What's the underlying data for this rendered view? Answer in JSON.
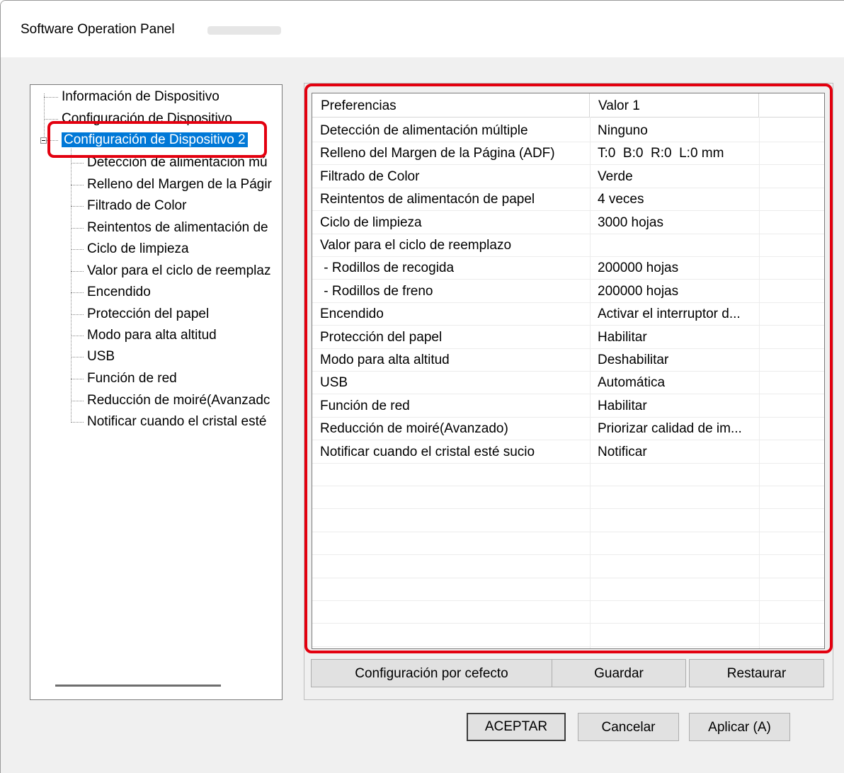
{
  "window": {
    "title": "Software Operation Panel"
  },
  "tree": {
    "items": [
      {
        "label": "Información de Dispositivo"
      },
      {
        "label": "Configuración de Dispositivo"
      },
      {
        "label": "Configuración de Dispositivo 2"
      },
      {
        "label": "Detección de alimentación mú"
      },
      {
        "label": "Relleno del Margen de la Págir"
      },
      {
        "label": "Filtrado de Color"
      },
      {
        "label": "Reintentos de alimentación de"
      },
      {
        "label": "Ciclo de limpieza"
      },
      {
        "label": "Valor para el ciclo de reemplaz"
      },
      {
        "label": "Encendido"
      },
      {
        "label": "Protección del papel"
      },
      {
        "label": "Modo para alta altitud"
      },
      {
        "label": "USB"
      },
      {
        "label": "Función de red"
      },
      {
        "label": "Reducción de moiré(Avanzadc"
      },
      {
        "label": "Notificar cuando el cristal esté"
      }
    ],
    "selected_index": 2
  },
  "table": {
    "headers": [
      "Preferencias",
      "Valor 1",
      ""
    ],
    "rows": [
      {
        "pref": "Detección de alimentación múltiple",
        "value": "Ninguno"
      },
      {
        "pref": "Relleno del Margen de la Página (ADF)",
        "value": "T:0  B:0  R:0  L:0 mm"
      },
      {
        "pref": "Filtrado de Color",
        "value": "Verde"
      },
      {
        "pref": "Reintentos de alimentacón de papel",
        "value": "4 veces"
      },
      {
        "pref": "Ciclo de limpieza",
        "value": "3000 hojas"
      },
      {
        "pref": "Valor para el ciclo de reemplazo",
        "value": ""
      },
      {
        "pref": " - Rodillos de recogida",
        "value": "200000 hojas"
      },
      {
        "pref": " - Rodillos de freno",
        "value": "200000 hojas"
      },
      {
        "pref": "Encendido",
        "value": "Activar el interruptor d..."
      },
      {
        "pref": "Protección del papel",
        "value": "Habilitar"
      },
      {
        "pref": "Modo para alta altitud",
        "value": "Deshabilitar"
      },
      {
        "pref": "USB",
        "value": "Automática"
      },
      {
        "pref": "Función de red",
        "value": "Habilitar"
      },
      {
        "pref": "Reducción de moiré(Avanzado)",
        "value": "Priorizar calidad de im..."
      },
      {
        "pref": "Notificar cuando el cristal esté sucio",
        "value": "Notificar"
      }
    ],
    "empty_rows": 8
  },
  "buttons": {
    "default_settings": "Configuración por cefecto",
    "save": "Guardar",
    "restore": "Restaurar",
    "ok": "ACEPTAR",
    "cancel": "Cancelar",
    "apply": "Aplicar (A)"
  },
  "colors": {
    "highlight": "#e3000f",
    "selection": "#0078d7"
  }
}
